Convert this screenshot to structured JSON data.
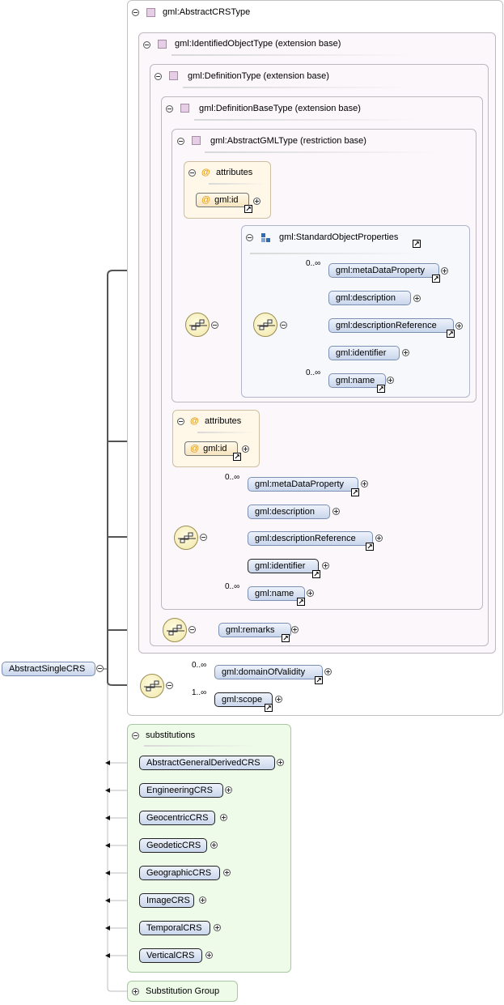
{
  "root": {
    "label": "AbstractSingleCRS"
  },
  "types": {
    "abstract_crs": "gml:AbstractCRSType",
    "identified_object": "gml:IdentifiedObjectType (extension base)",
    "definition": "gml:DefinitionType (extension base)",
    "definition_base": "gml:DefinitionBaseType (extension base)",
    "abstract_gml": "gml:AbstractGMLType (restriction base)"
  },
  "attributes": {
    "title": "attributes",
    "title2": "attributes",
    "id": "gml:id",
    "id2": "gml:id"
  },
  "standard_props": {
    "title": "gml:StandardObjectProperties",
    "items": [
      "gml:metaDataProperty",
      "gml:description",
      "gml:descriptionReference",
      "gml:identifier",
      "gml:name"
    ],
    "card_first": "0..∞",
    "card_last": "0..∞"
  },
  "definition_base_seq": {
    "items": [
      "gml:metaDataProperty",
      "gml:description",
      "gml:descriptionReference",
      "gml:identifier",
      "gml:name"
    ],
    "card_first": "0..∞",
    "card_last": "0..∞"
  },
  "remarks": "gml:remarks",
  "crs_seq": {
    "domain": "gml:domainOfValidity",
    "domain_card": "0..∞",
    "scope": "gml:scope",
    "scope_card": "1..∞"
  },
  "substitutions": {
    "title": "substitutions",
    "items": [
      "AbstractGeneralDerivedCRS",
      "EngineeringCRS",
      "GeocentricCRS",
      "GeodeticCRS",
      "GeographicCRS",
      "ImageCRS",
      "TemporalCRS",
      "VerticalCRS"
    ]
  },
  "substitution_group": "Substitution Group",
  "colors": {
    "panel_type": "#fbf7fb",
    "panel_attributes": "#fff8e8",
    "panel_substitutions": "#eefbe9",
    "panel_group": "#f7f8fc",
    "element_node": "#c9d6ec"
  },
  "icons": {
    "expanded": "collapse-toggle-icon",
    "collapsed": "expand-toggle-icon",
    "type": "complex-type-icon",
    "attribute": "attribute-icon",
    "sequence": "sequence-compositor-icon",
    "reference": "reference-arrow-icon",
    "group": "model-group-icon"
  }
}
